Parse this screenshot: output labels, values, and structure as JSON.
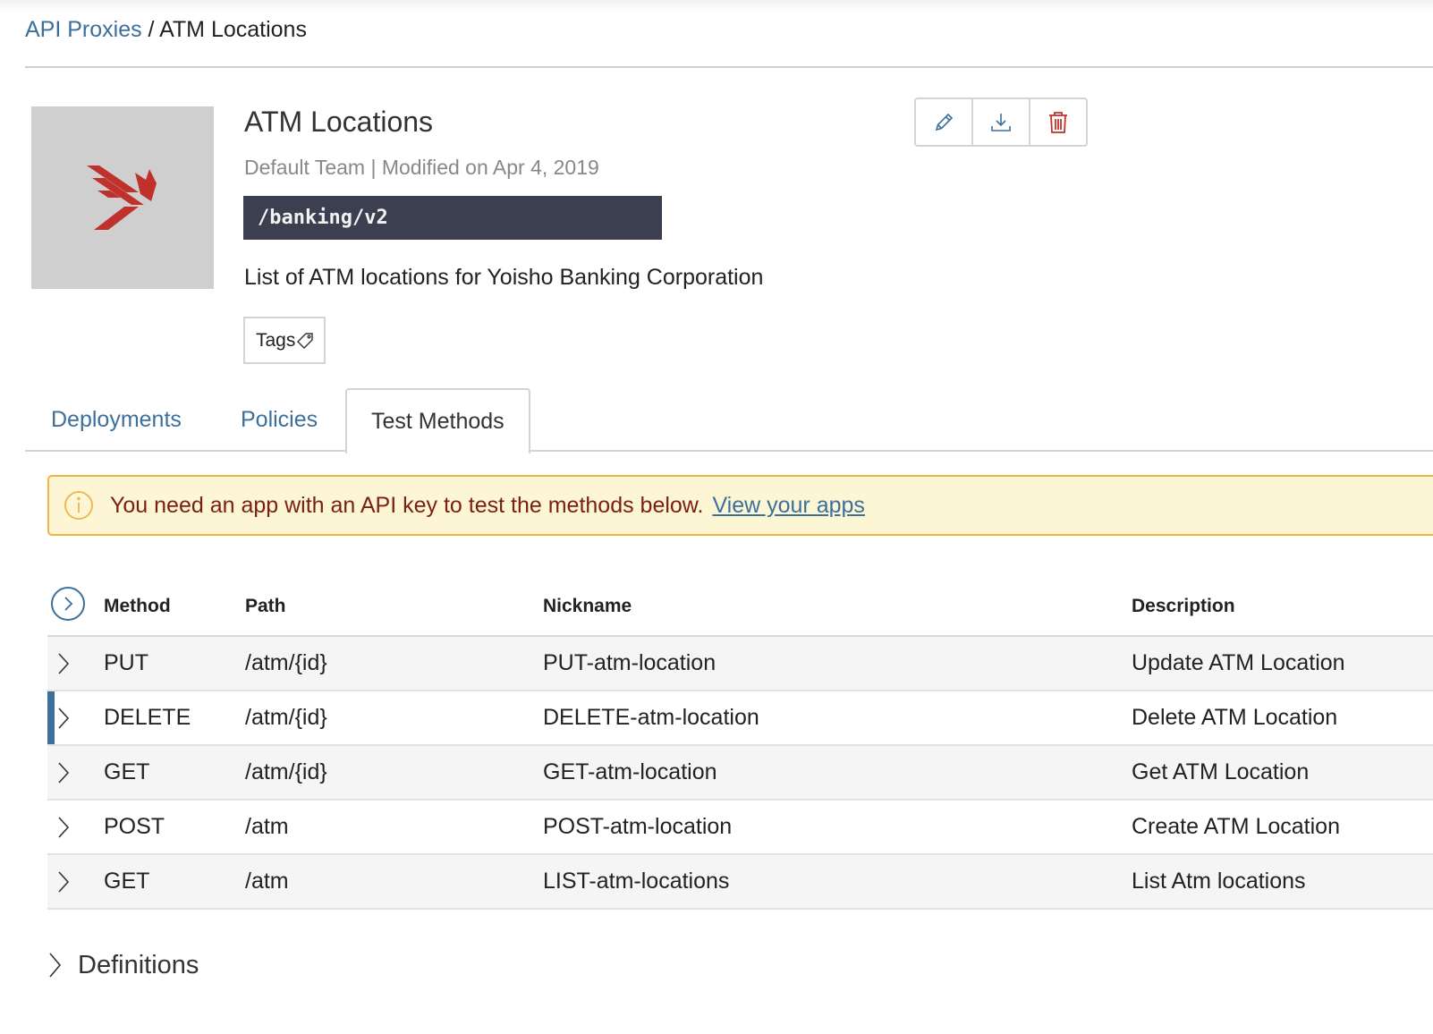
{
  "breadcrumb": {
    "parent": "API Proxies",
    "separator": " / ",
    "current": "ATM Locations"
  },
  "proxy": {
    "name": "ATM Locations",
    "team": "Default Team",
    "meta_separator": " | ",
    "modified": "Modified on Apr 4, 2019",
    "base_path": "/banking/v2",
    "description": "List of ATM locations for Yoisho Banking Corporation",
    "tags_label": "Tags"
  },
  "actions": [
    {
      "name": "edit",
      "icon": "pencil-icon"
    },
    {
      "name": "download",
      "icon": "download-icon"
    },
    {
      "name": "delete",
      "icon": "trash-icon"
    }
  ],
  "tabs": [
    {
      "label": "Deployments",
      "active": false
    },
    {
      "label": "Policies",
      "active": false
    },
    {
      "label": "Test Methods",
      "active": true
    }
  ],
  "alert": {
    "icon": "info-icon",
    "text": "You need an app with an API key to test the methods below.",
    "link": "View your apps"
  },
  "table": {
    "columns": [
      "Method",
      "Path",
      "Nickname",
      "Description"
    ],
    "rows": [
      {
        "method": "PUT",
        "path": "/atm/{id}",
        "nickname": "PUT-atm-location",
        "description": "Update ATM Location"
      },
      {
        "method": "DELETE",
        "path": "/atm/{id}",
        "nickname": "DELETE-atm-location",
        "description": "Delete ATM Location"
      },
      {
        "method": "GET",
        "path": "/atm/{id}",
        "nickname": "GET-atm-location",
        "description": "Get ATM Location"
      },
      {
        "method": "POST",
        "path": "/atm",
        "nickname": "POST-atm-location",
        "description": "Create ATM Location"
      },
      {
        "method": "GET",
        "path": "/atm",
        "nickname": "LIST-atm-locations",
        "description": "List Atm locations"
      }
    ]
  },
  "definitions_label": "Definitions",
  "colors": {
    "link": "#3d6f9b",
    "basepath_bg": "#3b3f4f",
    "alert_bg": "#fcf6d5",
    "alert_border": "#eeb447",
    "alert_text": "#7b1f14",
    "logo_red": "#c0312b",
    "selected_row_marker": "#3d6f9b"
  }
}
